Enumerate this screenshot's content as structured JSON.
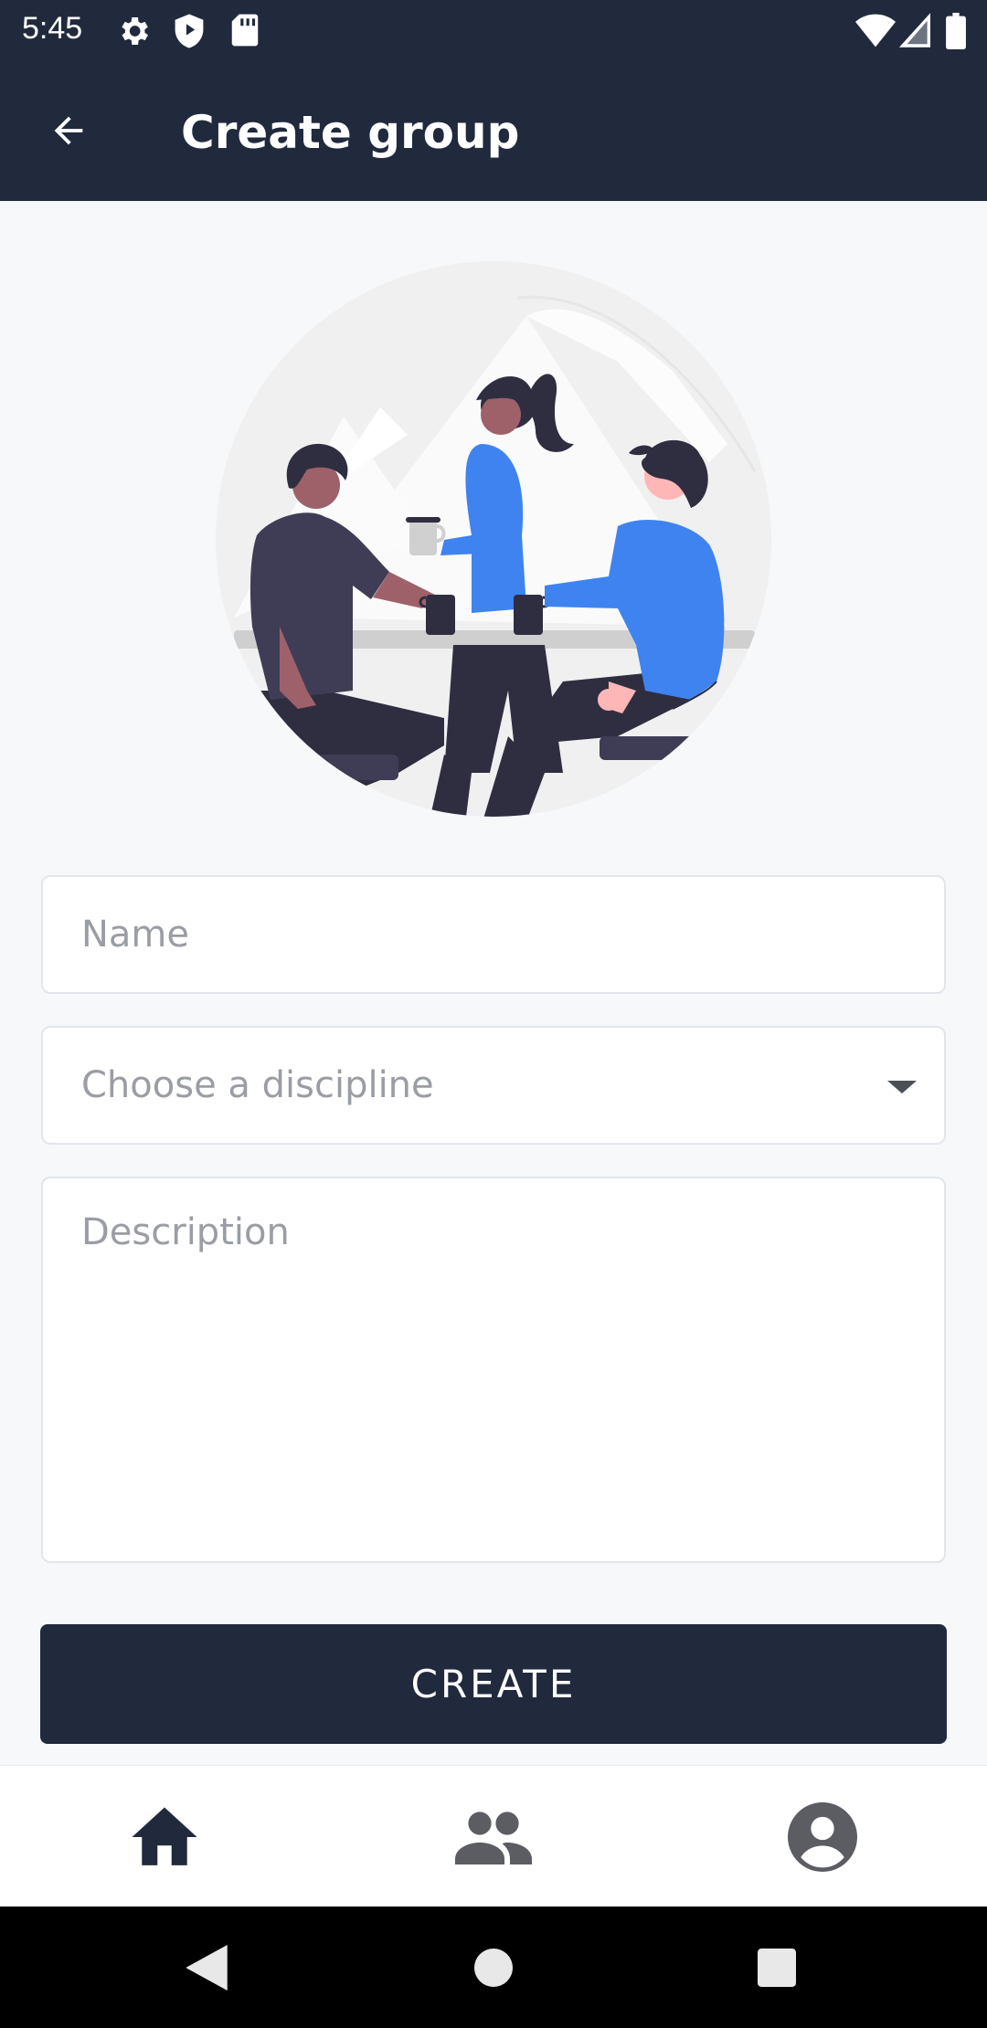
{
  "status_bar": {
    "time": "5:45",
    "left_icons": [
      "gear-icon",
      "shield-play-icon",
      "sd-card-icon"
    ],
    "right_icons": [
      "wifi-icon",
      "signal-icon",
      "battery-icon"
    ]
  },
  "app_bar": {
    "back_icon": "arrow-back-icon",
    "title": "Create group"
  },
  "hero": {
    "illustration": "people-meeting-illustration"
  },
  "form": {
    "name_placeholder": "Name",
    "discipline_placeholder": "Choose a discipline",
    "description_placeholder": "Description"
  },
  "create_label": "CREATE",
  "bottom_nav": {
    "items": [
      {
        "icon": "home-icon",
        "active": true
      },
      {
        "icon": "group-icon",
        "active": false
      },
      {
        "icon": "account-icon",
        "active": false
      }
    ]
  },
  "system_nav": [
    "back-triangle-icon",
    "home-circle-icon",
    "recents-square-icon"
  ],
  "colors": {
    "primary": "#212a3d",
    "accent": "#3f83f0",
    "background": "#f7f8fa"
  }
}
